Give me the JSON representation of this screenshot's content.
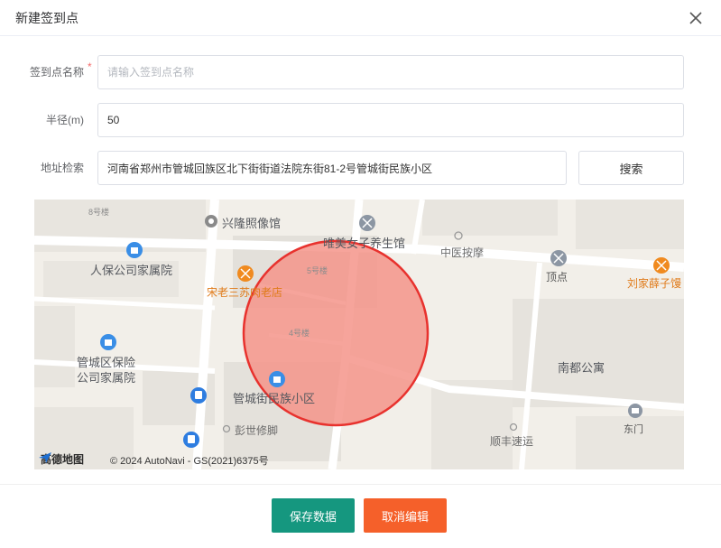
{
  "dialog": {
    "title": "新建签到点"
  },
  "form": {
    "name": {
      "label": "签到点名称",
      "required_mark": "*",
      "placeholder": "请输入签到点名称",
      "value": ""
    },
    "radius": {
      "label": "半径(m)",
      "value": "50"
    },
    "address": {
      "label": "地址检索",
      "value": "河南省郑州市管城回族区北下街街道法院东街81-2号管城街民族小区"
    },
    "search_label": "搜索"
  },
  "map": {
    "pois": {
      "xinglong": "兴隆照像馆",
      "weimei": "唯美女子养生馆",
      "zhongyi": "中医按摩",
      "dingdian": "顶点",
      "liujia": "刘家薛子馒",
      "renbao": "人保公司家属院",
      "songlao": "宋老三苏肉老店",
      "guanchengqu_1": "管城区保险",
      "guanchengqu_2": "公司家属院",
      "minzu": "管城街民族小区",
      "nandu": "南都公寓",
      "pengshi": "彭世修脚",
      "shunfeng": "顺丰速运",
      "dongmen": "东门"
    },
    "buildings": {
      "b8": "8号楼",
      "b5": "5号楼",
      "b4": "4号楼"
    },
    "logo_text": "高德地图",
    "copyright": "© 2024 AutoNavi - GS(2021)6375号",
    "circle": {
      "radius_m": 50
    },
    "colors": {
      "circle_fill": "#f4948a",
      "circle_stroke": "#e8322e"
    }
  },
  "actions": {
    "save_label": "保存数据",
    "cancel_label": "取消编辑"
  },
  "colors": {
    "save": "#15977f",
    "cancel": "#f5602a"
  }
}
